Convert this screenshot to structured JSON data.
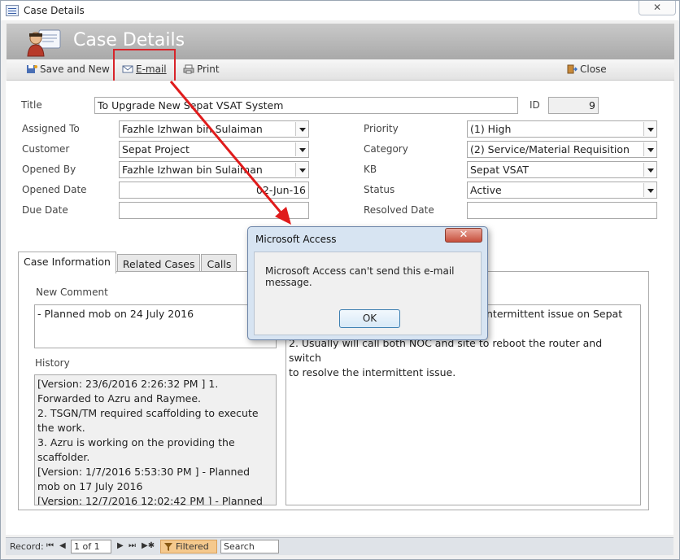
{
  "window": {
    "title": "Case Details",
    "close_glyph": "✕"
  },
  "header": {
    "title": "Case Details"
  },
  "toolbar": {
    "save_new": "Save and New",
    "email": "E-mail",
    "print": "Print",
    "close": "Close"
  },
  "form": {
    "title_label": "Title",
    "title_value": "To Upgrade New Sepat VSAT System",
    "id_label": "ID",
    "id_value": "9",
    "assigned_to_label": "Assigned To",
    "assigned_to_value": "Fazhle Izhwan bin Sulaiman",
    "customer_label": "Customer",
    "customer_value": "Sepat Project",
    "opened_by_label": "Opened By",
    "opened_by_value": "Fazhle Izhwan bin Sulaiman",
    "opened_date_label": "Opened Date",
    "opened_date_value": "02-Jun-16",
    "due_date_label": "Due Date",
    "due_date_value": "",
    "priority_label": "Priority",
    "priority_value": "(1) High",
    "category_label": "Category",
    "category_value": "(2) Service/Material Requisition",
    "kb_label": "KB",
    "kb_value": "Sepat VSAT",
    "status_label": "Status",
    "status_value": "Active",
    "resolved_date_label": "Resolved Date",
    "resolved_date_value": ""
  },
  "tabs": [
    {
      "label": "Case Information"
    },
    {
      "label": "Related Cases"
    },
    {
      "label": "Calls"
    }
  ],
  "case_info": {
    "new_comment_label": "New Comment",
    "new_comment_value": "- Planned mob on 24 July 2016",
    "history_label": "History",
    "history_lines": [
      "[Version:  23/6/2016 2:26:32 PM ] 1.",
      "Forwarded to Azru and Raymee.",
      "2. TSGN/TM required scaffolding to execute",
      "the work.",
      "3. Azru is working on the providing the",
      "scaffolder.",
      "[Version:  1/7/2016 5:53:30 PM ] - Planned",
      "mob on 17 July 2016",
      "[Version:  12/7/2016 12:02:42 PM ] - Planned"
    ],
    "description_lines": [
      "ntermittent issue on Sepat",
      "",
      "2. Usually will call both NOC and site to reboot the router and switch",
      "to resolve the intermittent issue."
    ]
  },
  "statusbar": {
    "record_label": "Record:",
    "first": "⏮",
    "prev": "◀",
    "record_value": "1 of 1",
    "next": "▶",
    "last": "⏭",
    "new": "▶✱",
    "filtered": "Filtered",
    "search": "Search"
  },
  "dialog": {
    "title": "Microsoft Access",
    "close_glyph": "✕",
    "message": "Microsoft Access can't send this e-mail message.",
    "ok": "OK"
  },
  "colors": {
    "highlight_box": "#d8242a",
    "arrow": "#e01b1b",
    "filtered_bg": "#f5c98d"
  }
}
